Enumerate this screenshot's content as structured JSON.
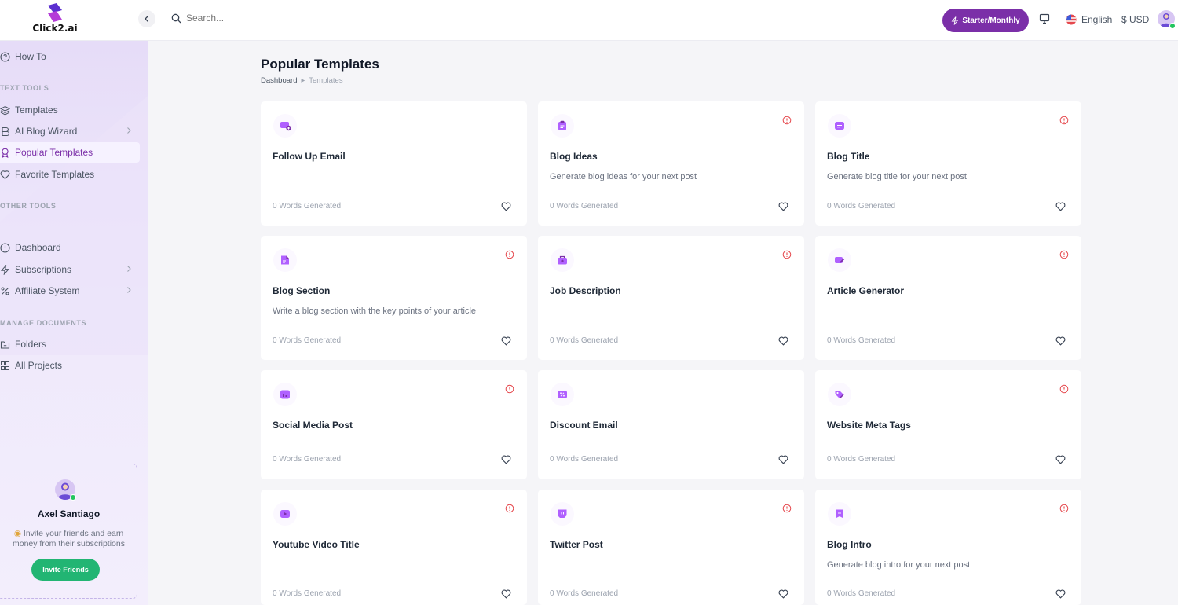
{
  "app": {
    "logo_text": "Click2.ai"
  },
  "topbar": {
    "search_placeholder": "Search...",
    "plan_label": "Starter/Monthly",
    "language": "English",
    "currency": "$ USD"
  },
  "sidebar": {
    "how_to": "How To",
    "sections": {
      "text_tools": "TEXT TOOLS",
      "other_tools": "OTHER TOOLS",
      "manage_documents": "MANAGE DOCUMENTS"
    },
    "text_tools": [
      {
        "label": "Templates",
        "icon": "layers-icon"
      },
      {
        "label": "AI Blog Wizard",
        "icon": "blog-icon",
        "has_submenu": true
      },
      {
        "label": "Popular Templates",
        "icon": "award-icon",
        "active": true
      },
      {
        "label": "Favorite Templates",
        "icon": "heart-icon"
      }
    ],
    "other_tools": [
      {
        "label": "Dashboard",
        "icon": "clock-icon"
      },
      {
        "label": "Subscriptions",
        "icon": "zap-icon",
        "has_submenu": true
      },
      {
        "label": "Affiliate System",
        "icon": "percent-icon",
        "has_submenu": true
      }
    ],
    "manage_documents": [
      {
        "label": "Folders",
        "icon": "folder-icon"
      },
      {
        "label": "All Projects",
        "icon": "grid-icon"
      }
    ],
    "invite": {
      "name": "Axel Santiago",
      "text": "Invite your friends and earn money from their subscriptions",
      "button": "Invite Friends"
    }
  },
  "main": {
    "title": "Popular Templates",
    "breadcrumb": [
      "Dashboard",
      "Templates"
    ],
    "cards": [
      {
        "title": "Follow Up Email",
        "description": "",
        "words": "0 Words Generated",
        "icon": "mail-plus-icon",
        "info": false
      },
      {
        "title": "Blog Ideas",
        "description": "Generate blog ideas for your next post",
        "words": "0 Words Generated",
        "icon": "clipboard-icon",
        "info": true
      },
      {
        "title": "Blog Title",
        "description": "Generate blog title for your next post",
        "words": "0 Words Generated",
        "icon": "title-icon",
        "info": true
      },
      {
        "title": "Blog Section",
        "description": "Write a blog section with the key points of your article",
        "words": "0 Words Generated",
        "icon": "document-icon",
        "info": true
      },
      {
        "title": "Job Description",
        "description": "",
        "words": "0 Words Generated",
        "icon": "briefcase-icon",
        "info": true
      },
      {
        "title": "Article Generator",
        "description": "",
        "words": "0 Words Generated",
        "icon": "edit-icon",
        "info": true
      },
      {
        "title": "Social Media Post",
        "description": "",
        "words": "0 Words Generated",
        "icon": "chart-icon",
        "info": true
      },
      {
        "title": "Discount Email",
        "description": "",
        "words": "0 Words Generated",
        "icon": "discount-icon",
        "info": false
      },
      {
        "title": "Website Meta Tags",
        "description": "",
        "words": "0 Words Generated",
        "icon": "tag-icon",
        "info": true
      },
      {
        "title": "Youtube Video Title",
        "description": "",
        "words": "0 Words Generated",
        "icon": "play-icon",
        "info": true
      },
      {
        "title": "Twitter Post",
        "description": "",
        "words": "0 Words Generated",
        "icon": "twitch-icon",
        "info": true
      },
      {
        "title": "Blog Intro",
        "description": "Generate blog intro for your next post",
        "words": "0 Words Generated",
        "icon": "bookmark-icon",
        "info": true
      }
    ]
  },
  "colors": {
    "accent": "#7b2fa8",
    "icon_purple": "#b060ff",
    "info_red": "#e5484d",
    "invite_green": "#22b573"
  }
}
